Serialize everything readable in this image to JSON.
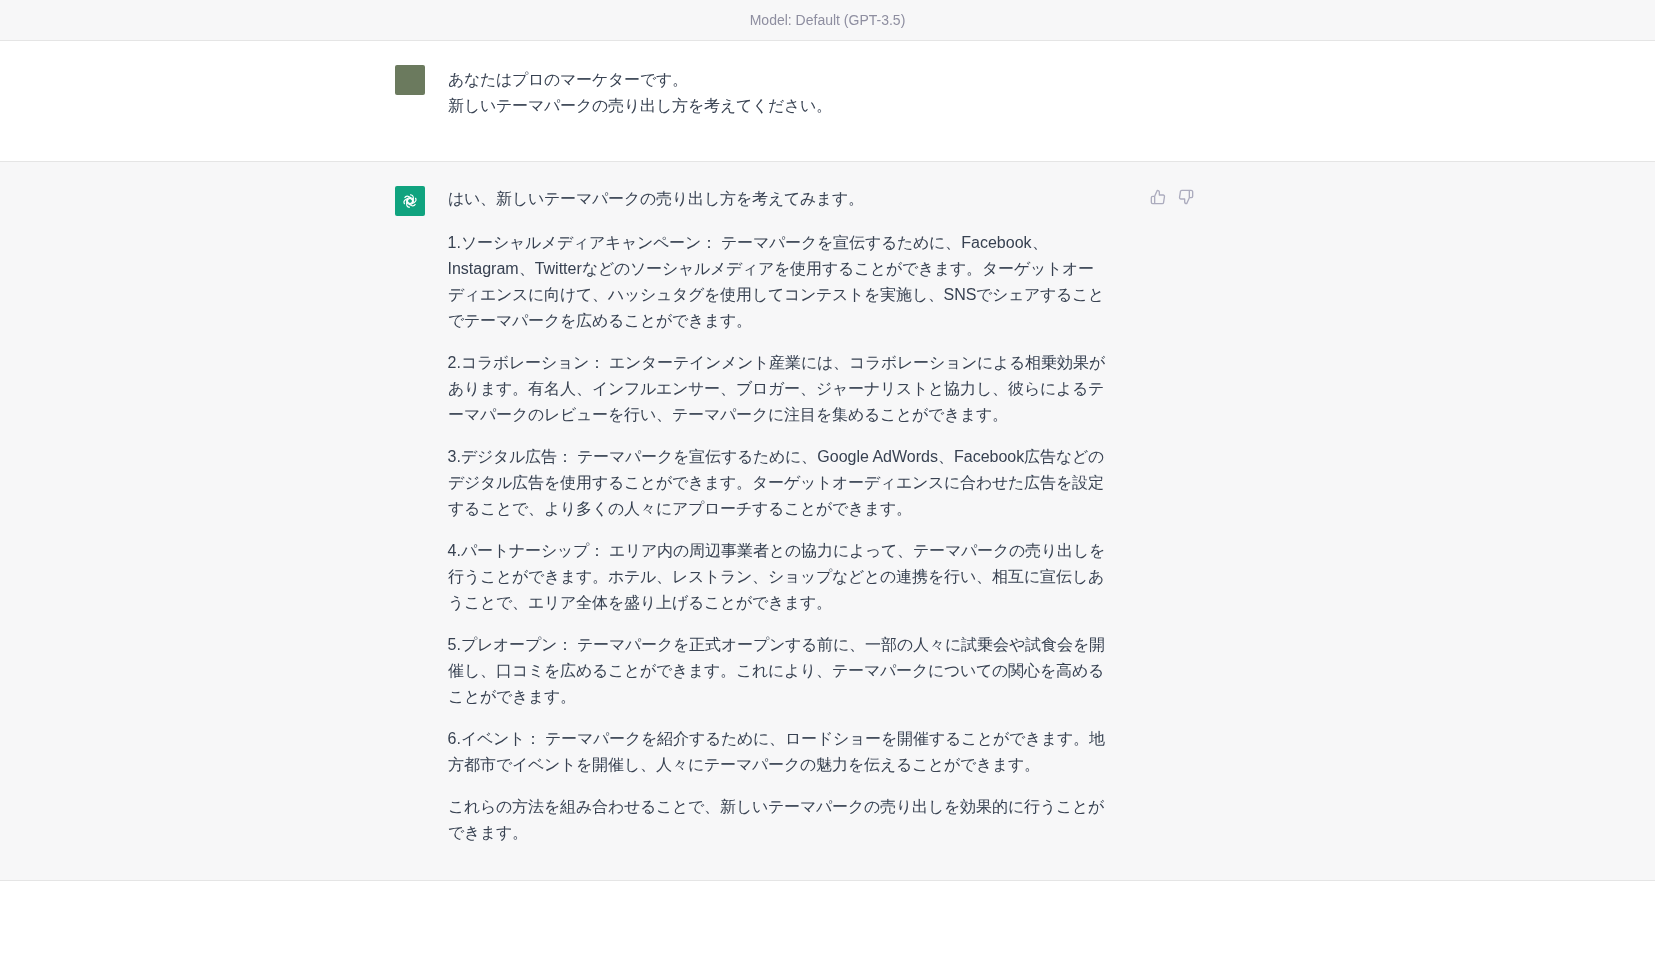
{
  "header": {
    "model_label": "Model: Default (GPT-3.5)"
  },
  "user_message": {
    "lines": [
      "あなたはプロのマーケターです。",
      "新しいテーマパークの売り出し方を考えてください。"
    ]
  },
  "assistant_message": {
    "paragraphs": [
      "はい、新しいテーマパークの売り出し方を考えてみます。",
      "1.ソーシャルメディアキャンペーン： テーマパークを宣伝するために、Facebook、Instagram、Twitterなどのソーシャルメディアを使用することができます。ターゲットオーディエンスに向けて、ハッシュタグを使用してコンテストを実施し、SNSでシェアすることでテーマパークを広めることができます。",
      "2.コラボレーション： エンターテインメント産業には、コラボレーションによる相乗効果があります。有名人、インフルエンサー、ブロガー、ジャーナリストと協力し、彼らによるテーマパークのレビューを行い、テーマパークに注目を集めることができます。",
      "3.デジタル広告： テーマパークを宣伝するために、Google AdWords、Facebook広告などのデジタル広告を使用することができます。ターゲットオーディエンスに合わせた広告を設定することで、より多くの人々にアプローチすることができます。",
      "4.パートナーシップ： エリア内の周辺事業者との協力によって、テーマパークの売り出しを行うことができます。ホテル、レストラン、ショップなどとの連携を行い、相互に宣伝しあうことで、エリア全体を盛り上げることができます。",
      "5.プレオープン： テーマパークを正式オープンする前に、一部の人々に試乗会や試食会を開催し、口コミを広めることができます。これにより、テーマパークについての関心を高めることができます。",
      "6.イベント： テーマパークを紹介するために、ロードショーを開催することができます。地方都市でイベントを開催し、人々にテーマパークの魅力を伝えることができます。",
      "これらの方法を組み合わせることで、新しいテーマパークの売り出しを効果的に行うことができます。"
    ]
  }
}
